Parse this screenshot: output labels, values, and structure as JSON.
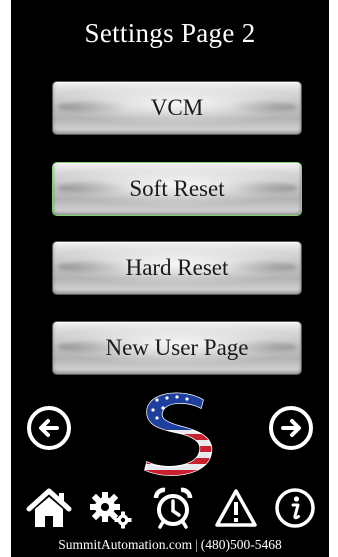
{
  "title": "Settings Page 2",
  "buttons": {
    "vcm": "VCM",
    "soft_reset": "Soft Reset",
    "hard_reset": "Hard Reset",
    "new_user_page": "New User Page"
  },
  "icons": {
    "prev": "arrow-left-circle-icon",
    "next": "arrow-right-circle-icon",
    "logo": "summit-automation-logo",
    "home": "home-icon",
    "settings": "gears-icon",
    "alarm": "alarm-clock-icon",
    "warning": "warning-icon",
    "info": "info-icon"
  },
  "footer": {
    "website": "SummitAutomation.com",
    "separator": "|",
    "phone": "(480)500-5468"
  }
}
